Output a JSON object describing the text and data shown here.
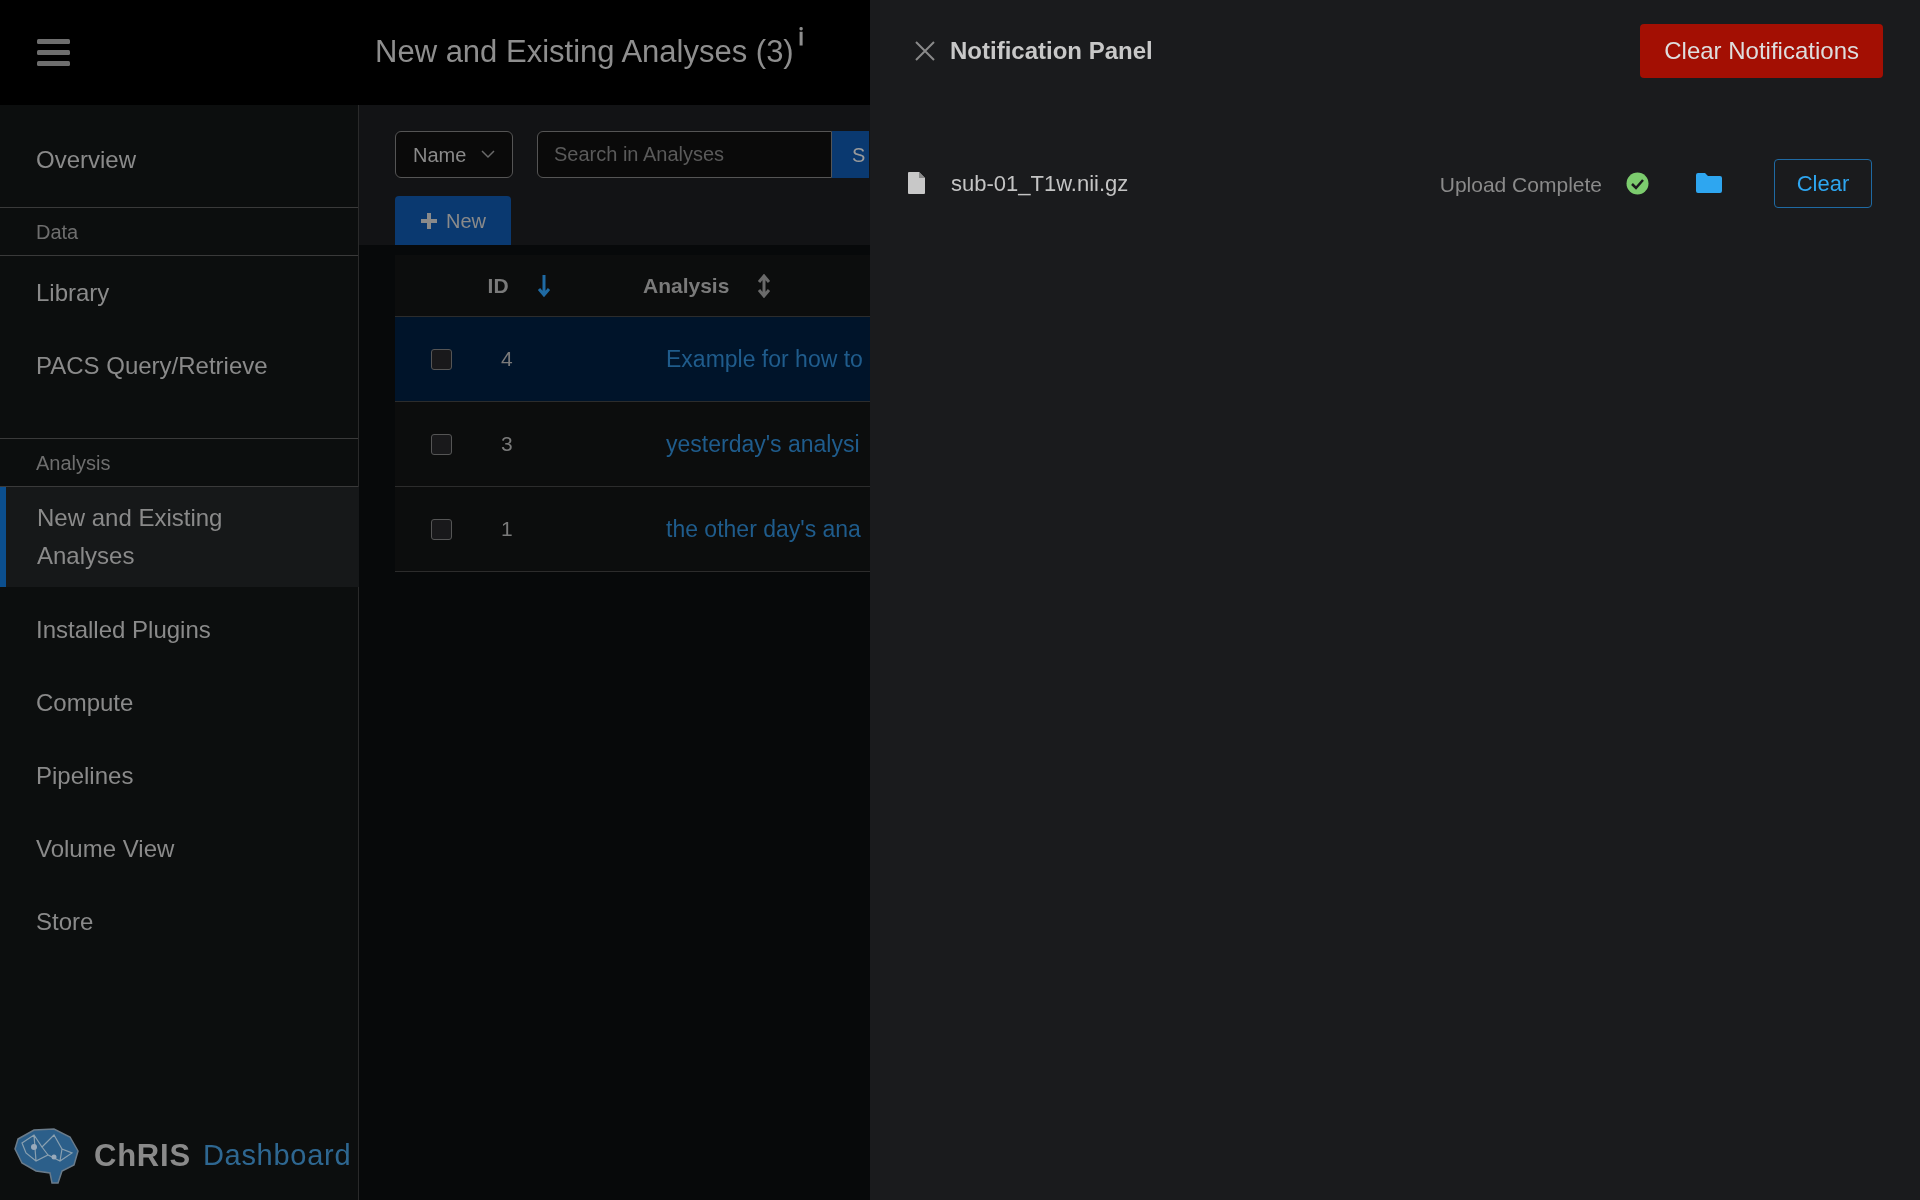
{
  "header": {
    "title": "New and Existing Analyses (3)",
    "info_icon": "ℹ"
  },
  "sidebar": {
    "items": [
      {
        "kind": "item",
        "label": "Overview",
        "selected": false
      },
      {
        "kind": "section",
        "label": "Data"
      },
      {
        "kind": "item",
        "label": "Library",
        "selected": false
      },
      {
        "kind": "item",
        "label": "PACS Query/Retrieve",
        "selected": false
      },
      {
        "kind": "section",
        "label": "Analysis"
      },
      {
        "kind": "item",
        "label": "New and Existing Analyses",
        "selected": true
      },
      {
        "kind": "item",
        "label": "Installed Plugins",
        "selected": false
      },
      {
        "kind": "item",
        "label": "Compute",
        "selected": false
      },
      {
        "kind": "item",
        "label": "Pipelines",
        "selected": false
      },
      {
        "kind": "item",
        "label": "Volume View",
        "selected": false
      },
      {
        "kind": "item",
        "label": "Store",
        "selected": false
      }
    ],
    "logo": {
      "name": "ChRIS",
      "subtitle": "Dashboard"
    }
  },
  "toolbar": {
    "filter": "Name",
    "search": {
      "placeholder": "Search in Analyses"
    },
    "search_button": "S",
    "new_button": "New"
  },
  "table": {
    "columns": [
      {
        "label": "ID",
        "sorted": true
      },
      {
        "label": "Analysis",
        "sorted": false
      }
    ],
    "rows": [
      {
        "id": "4",
        "analysis": "Example for how to",
        "selected": true,
        "checked": false
      },
      {
        "id": "3",
        "analysis": "yesterday's analysi",
        "selected": false,
        "checked": false
      },
      {
        "id": "1",
        "analysis": "the other day's ana",
        "selected": false,
        "checked": false
      }
    ]
  },
  "notification_panel": {
    "title": "Notification Panel",
    "clear_all": "Clear Notifications",
    "notifications": [
      {
        "file": "sub-01_T1w.nii.gz",
        "status": "Upload Complete",
        "complete": true,
        "action": "Clear"
      }
    ]
  }
}
